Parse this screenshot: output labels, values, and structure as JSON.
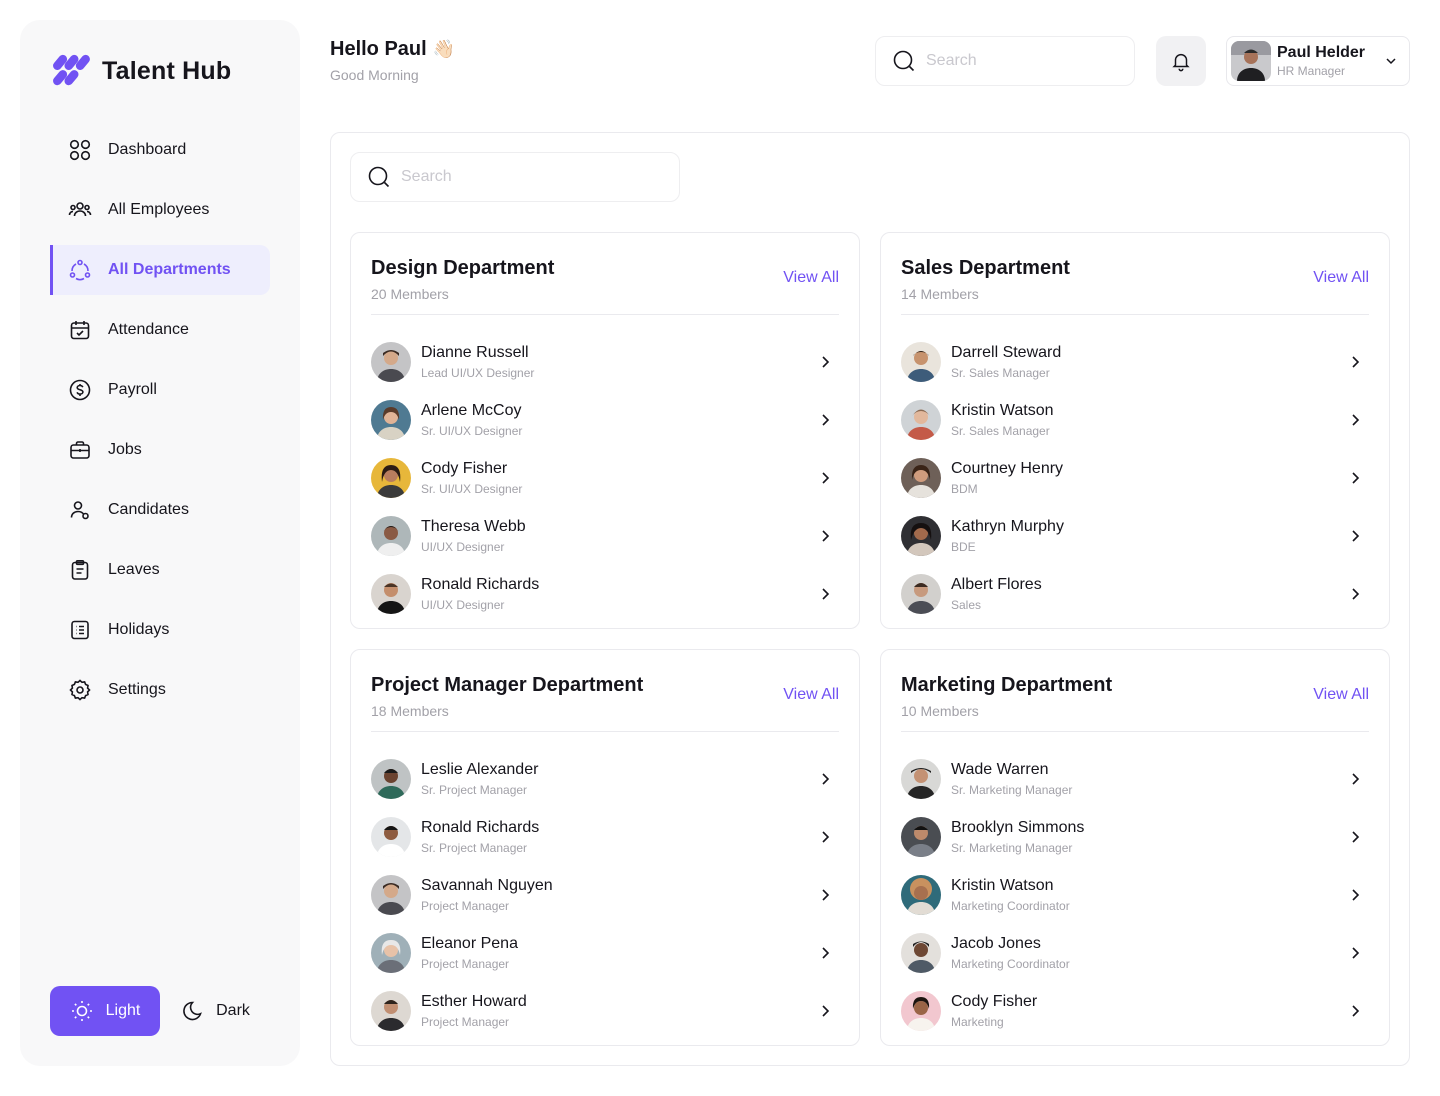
{
  "brand": {
    "name": "Talent Hub",
    "accent": "#7152F3"
  },
  "nav": [
    {
      "label": "Dashboard",
      "icon": "dashboard-icon",
      "active": false
    },
    {
      "label": "All Employees",
      "icon": "users-icon",
      "active": false
    },
    {
      "label": "All Departments",
      "icon": "departments-icon",
      "active": true
    },
    {
      "label": "Attendance",
      "icon": "calendar-check-icon",
      "active": false
    },
    {
      "label": "Payroll",
      "icon": "dollar-icon",
      "active": false
    },
    {
      "label": "Jobs",
      "icon": "briefcase-icon",
      "active": false
    },
    {
      "label": "Candidates",
      "icon": "candidates-icon",
      "active": false
    },
    {
      "label": "Leaves",
      "icon": "clipboard-icon",
      "active": false
    },
    {
      "label": "Holidays",
      "icon": "list-icon",
      "active": false
    },
    {
      "label": "Settings",
      "icon": "gear-icon",
      "active": false
    }
  ],
  "theme": {
    "light_label": "Light",
    "dark_label": "Dark",
    "selected": "Light"
  },
  "header": {
    "greeting": "Hello Paul",
    "greeting_emoji": "👋🏻",
    "subtitle": "Good Morning",
    "search_placeholder": "Search",
    "user": {
      "name": "Paul Helder",
      "role": "HR Manager"
    }
  },
  "content": {
    "search_placeholder": "Search",
    "departments": [
      {
        "title": "Design Department",
        "count": "20 Members",
        "view_all": "View All",
        "members": [
          {
            "name": "Dianne Russell",
            "role": "Lead UI/UX Designer"
          },
          {
            "name": "Arlene McCoy",
            "role": "Sr. UI/UX Designer"
          },
          {
            "name": "Cody Fisher",
            "role": "Sr. UI/UX Designer"
          },
          {
            "name": "Theresa Webb",
            "role": "UI/UX Designer"
          },
          {
            "name": "Ronald Richards",
            "role": "UI/UX Designer"
          }
        ]
      },
      {
        "title": "Sales Department",
        "count": "14 Members",
        "view_all": "View All",
        "members": [
          {
            "name": "Darrell Steward",
            "role": "Sr. Sales Manager"
          },
          {
            "name": "Kristin Watson",
            "role": "Sr. Sales Manager"
          },
          {
            "name": "Courtney Henry",
            "role": "BDM"
          },
          {
            "name": "Kathryn Murphy",
            "role": "BDE"
          },
          {
            "name": "Albert Flores",
            "role": "Sales"
          }
        ]
      },
      {
        "title": "Project Manager Department",
        "count": "18 Members",
        "view_all": "View All",
        "members": [
          {
            "name": "Leslie Alexander",
            "role": "Sr. Project Manager"
          },
          {
            "name": "Ronald Richards",
            "role": "Sr. Project Manager"
          },
          {
            "name": "Savannah Nguyen",
            "role": "Project Manager"
          },
          {
            "name": "Eleanor Pena",
            "role": "Project Manager"
          },
          {
            "name": "Esther Howard",
            "role": "Project Manager"
          }
        ]
      },
      {
        "title": "Marketing Department",
        "count": "10 Members",
        "view_all": "View All",
        "members": [
          {
            "name": "Wade Warren",
            "role": "Sr. Marketing Manager"
          },
          {
            "name": "Brooklyn Simmons",
            "role": "Sr. Marketing Manager"
          },
          {
            "name": "Kristin Watson",
            "role": "Marketing Coordinator"
          },
          {
            "name": "Jacob Jones",
            "role": "Marketing Coordinator"
          },
          {
            "name": "Cody Fisher",
            "role": "Marketing"
          }
        ]
      }
    ]
  }
}
